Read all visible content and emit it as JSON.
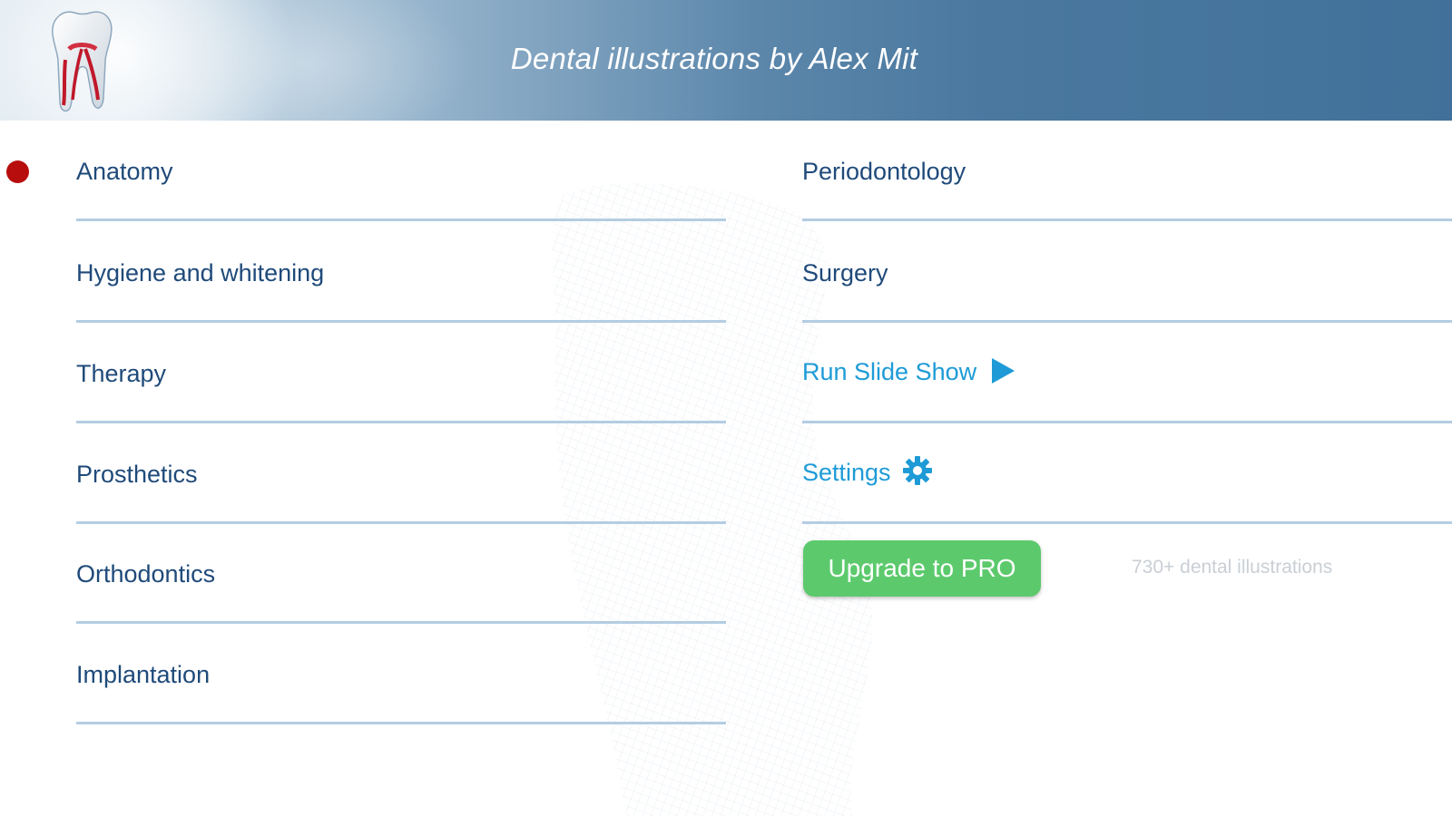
{
  "header": {
    "title": "Dental illustrations by Alex Mit",
    "logo_icon": "tooth-root-canal-icon"
  },
  "menu": {
    "left": [
      {
        "label": "Anatomy",
        "selected": true
      },
      {
        "label": "Hygiene and whitening",
        "selected": false
      },
      {
        "label": "Therapy",
        "selected": false
      },
      {
        "label": "Prosthetics",
        "selected": false
      },
      {
        "label": "Orthodontics",
        "selected": false
      },
      {
        "label": "Implantation",
        "selected": false
      }
    ],
    "right": [
      {
        "label": "Periodontology"
      },
      {
        "label": "Surgery"
      }
    ]
  },
  "actions": {
    "slideshow_label": "Run Slide Show",
    "slideshow_icon": "play-icon",
    "settings_label": "Settings",
    "settings_icon": "gear-icon"
  },
  "upgrade": {
    "button_label": "Upgrade to PRO",
    "note": "730+ dental illustrations"
  },
  "colors": {
    "header_blue": "#41719a",
    "menu_text": "#1f4a7a",
    "action_text": "#1e9bd7",
    "divider": "#b4cde2",
    "selected_dot": "#b80d0d",
    "upgrade_green": "#5cca6c"
  }
}
